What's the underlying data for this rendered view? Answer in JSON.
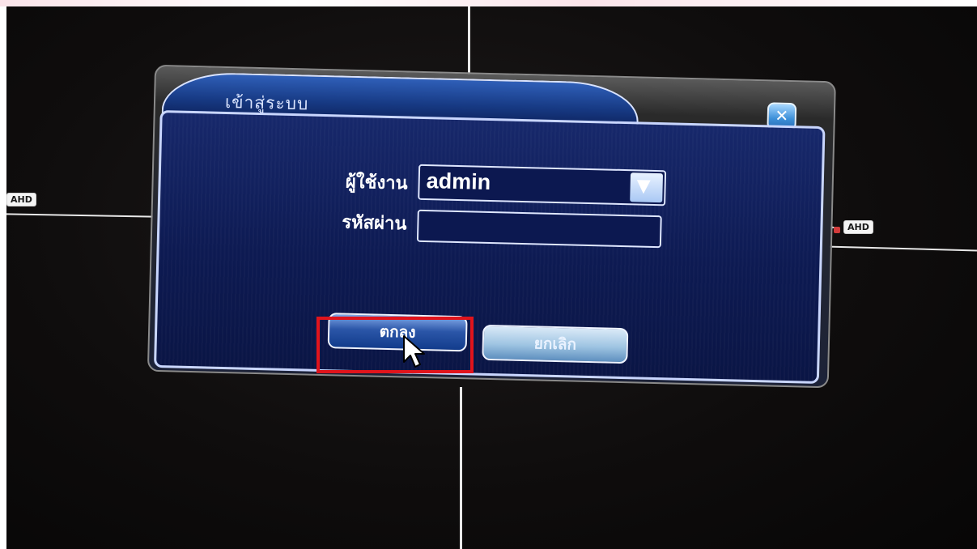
{
  "dialog": {
    "title": "เข้าสู่ระบบ",
    "close_icon": "close-x-icon",
    "username_label": "ผู้ใช้งาน",
    "username_value": "admin",
    "password_label": "รหัสผ่าน",
    "password_value": "",
    "ok_label": "ตกลง",
    "cancel_label": "ยกเลิก"
  },
  "camera_tiles": {
    "left_tag": "AHD",
    "right_tag": "AHD"
  },
  "colors": {
    "highlight": "#e0141c",
    "dialog_blue": "#17286b",
    "title_blue": "#2f5fb8"
  }
}
